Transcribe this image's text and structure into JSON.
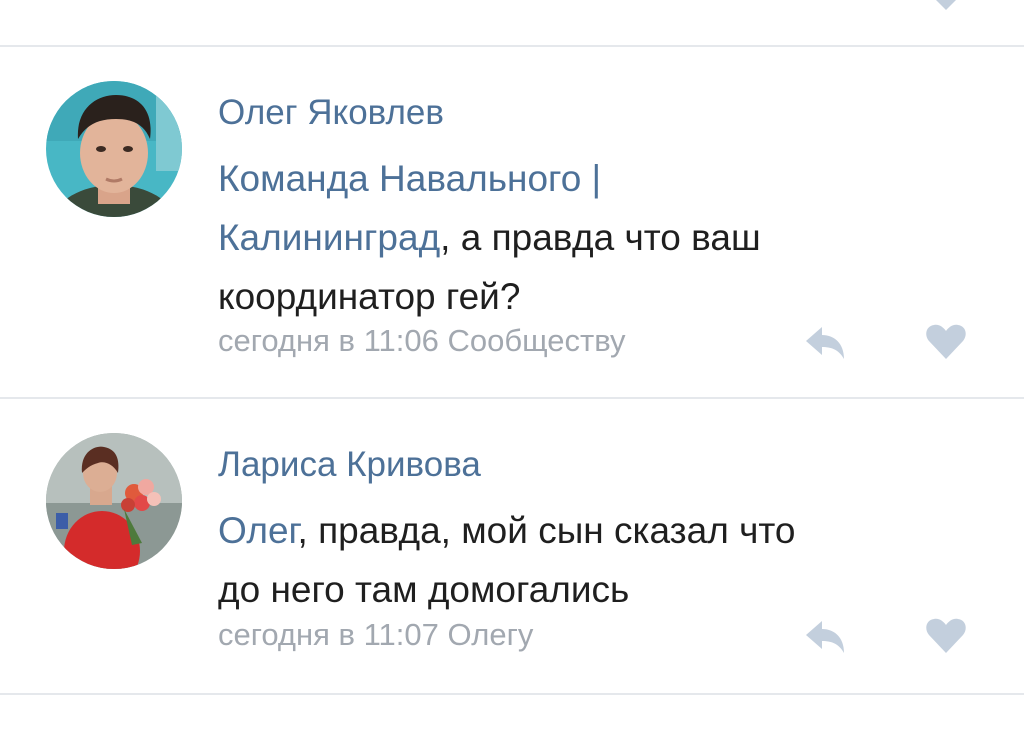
{
  "comments": [
    {
      "author": "Олег Яковлев",
      "mention_line1": "Команда Навального |",
      "mention_line2": "Калининград",
      "text_line2_rest": ", а правда что ваш",
      "text_line3": "координатор гей?",
      "timestamp": "сегодня в 11:06",
      "reply_target": "Сообществу",
      "reply_icon": "reply-arrow-icon",
      "like_icon": "heart-icon"
    },
    {
      "author": "Лариса Кривова",
      "mention": "Олег",
      "text_line1_rest": ", правда, мой сын сказал что",
      "text_line2": "до него там домогались",
      "timestamp": "сегодня в 11:07",
      "reply_target": "Олегу",
      "reply_icon": "reply-arrow-icon",
      "like_icon": "heart-icon"
    }
  ],
  "colors": {
    "link": "#4d7198",
    "text": "#1f1f1f",
    "meta": "#a2a8b0",
    "icon": "#c3cfdd",
    "divider": "#e5e8ec"
  }
}
